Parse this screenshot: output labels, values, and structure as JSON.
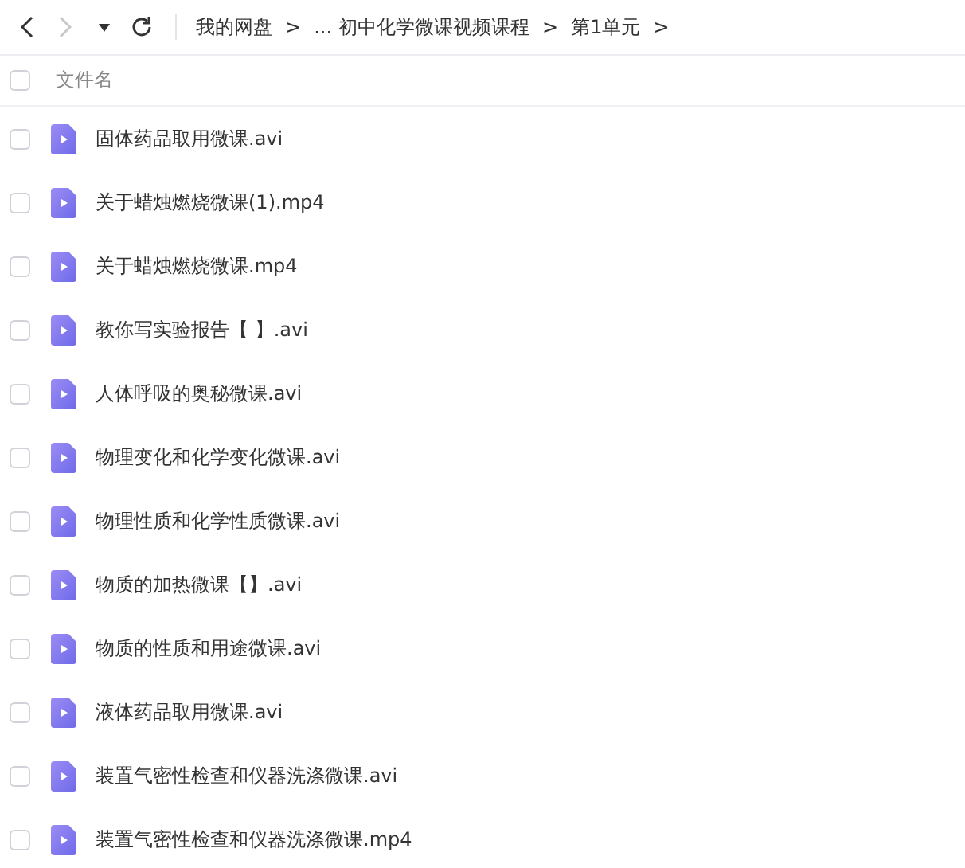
{
  "toolbar": {
    "nav": [
      {
        "kind": "back",
        "disabled": false
      },
      {
        "kind": "forward",
        "disabled": true
      },
      {
        "kind": "history",
        "disabled": false
      },
      {
        "kind": "refresh",
        "disabled": false
      }
    ],
    "breadcrumb": [
      {
        "label": "我的网盘",
        "separator": ">"
      },
      {
        "label": "..."
      },
      {
        "label": "初中化学微课视频课程",
        "separator": ">"
      },
      {
        "label": "第1单元",
        "separator": ">"
      }
    ]
  },
  "header": {
    "checked": false,
    "column": "文件名"
  },
  "files": [
    {
      "name": "固体药品取用微课.avi",
      "checked": false
    },
    {
      "name": "关于蜡烛燃烧微课(1).mp4",
      "checked": false
    },
    {
      "name": "关于蜡烛燃烧微课.mp4",
      "checked": false
    },
    {
      "name": "教你写实验报告【 】.avi",
      "checked": false
    },
    {
      "name": "人体呼吸的奥秘微课.avi",
      "checked": false
    },
    {
      "name": "物理变化和化学变化微课.avi",
      "checked": false
    },
    {
      "name": "物理性质和化学性质微课.avi",
      "checked": false
    },
    {
      "name": "物质的加热微课【】.avi",
      "checked": false
    },
    {
      "name": "物质的性质和用途微课.avi",
      "checked": false
    },
    {
      "name": "液体药品取用微课.avi",
      "checked": false
    },
    {
      "name": "装置气密性检查和仪器洗涤微课.avi",
      "checked": false
    },
    {
      "name": "装置气密性检查和仪器洗涤微课.mp4",
      "checked": false
    }
  ]
}
